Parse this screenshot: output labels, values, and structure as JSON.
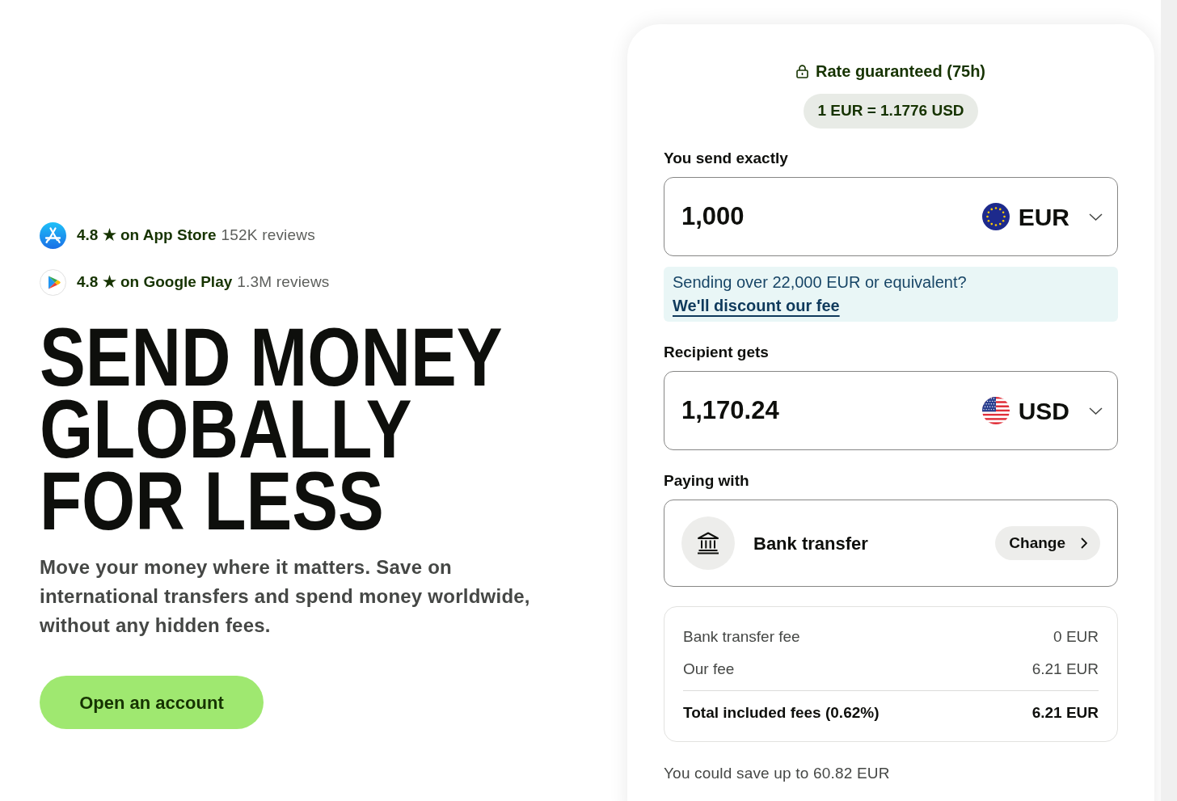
{
  "ratings": [
    {
      "rating": "4.8 ★ on App Store",
      "reviews": "152K reviews"
    },
    {
      "rating": "4.8 ★ on Google Play",
      "reviews": "1.3M reviews"
    }
  ],
  "headline": "SEND MONEY GLOBALLY FOR LESS",
  "intro": "Move your money where it matters. Save on international transfers and spend money worldwide, without any hidden fees.",
  "cta": "Open an account",
  "calculator": {
    "rate": {
      "guarantee": "Rate guaranteed (75h)",
      "value": "1 EUR = 1.1776 USD"
    },
    "send": {
      "label": "You send exactly",
      "amount": "1,000",
      "currency": "EUR"
    },
    "notice": {
      "text": "Sending over 22,000 EUR or equivalent?",
      "link": "We'll discount our fee"
    },
    "receive": {
      "label": "Recipient gets",
      "amount": "1,170.24",
      "currency": "USD"
    },
    "payment": {
      "label": "Paying with",
      "method": "Bank transfer",
      "action": "Change"
    },
    "fees": [
      {
        "kind": "fee",
        "label": "Bank transfer fee",
        "amount": "0 EUR"
      },
      {
        "kind": "fee",
        "label": "Our fee",
        "amount": "6.21 EUR"
      },
      {
        "kind": "total",
        "label": "Total included fees (0.62%)",
        "amount": "6.21 EUR"
      }
    ],
    "savings": "You could save up to 60.82 EUR"
  }
}
